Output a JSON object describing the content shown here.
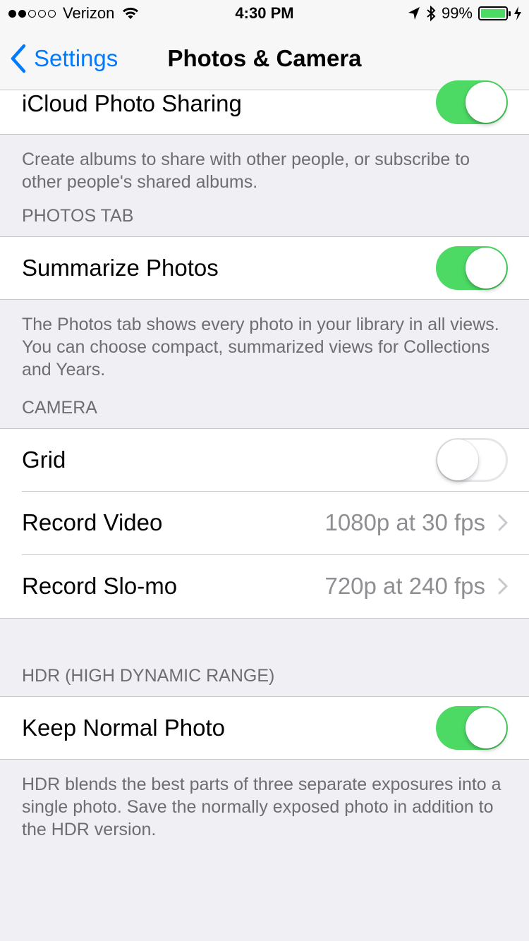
{
  "status_bar": {
    "carrier": "Verizon",
    "signal_dots_full": 2,
    "signal_dots_total": 5,
    "time": "4:30 PM",
    "battery_percent": "99%",
    "battery_color": "#4cd964"
  },
  "nav": {
    "back_label": "Settings",
    "title": "Photos & Camera"
  },
  "icloud_sharing": {
    "label": "iCloud Photo Sharing",
    "toggle_on": true,
    "footer": "Create albums to share with other people, or subscribe to other people's shared albums."
  },
  "photos_tab": {
    "header": "PHOTOS TAB",
    "summarize_label": "Summarize Photos",
    "summarize_on": true,
    "footer": "The Photos tab shows every photo in your library in all views. You can choose compact, summarized views for Collections and Years."
  },
  "camera": {
    "header": "CAMERA",
    "grid_label": "Grid",
    "grid_on": false,
    "record_video_label": "Record Video",
    "record_video_value": "1080p at 30 fps",
    "record_slomo_label": "Record Slo-mo",
    "record_slomo_value": "720p at 240 fps"
  },
  "hdr": {
    "header": "HDR (HIGH DYNAMIC RANGE)",
    "keep_normal_label": "Keep Normal Photo",
    "keep_normal_on": true,
    "footer": "HDR blends the best parts of three separate exposures into a single photo. Save the normally exposed photo in addition to the HDR version."
  },
  "colors": {
    "accent": "#007aff",
    "toggle_on": "#4cd964",
    "background": "#efeff4"
  }
}
